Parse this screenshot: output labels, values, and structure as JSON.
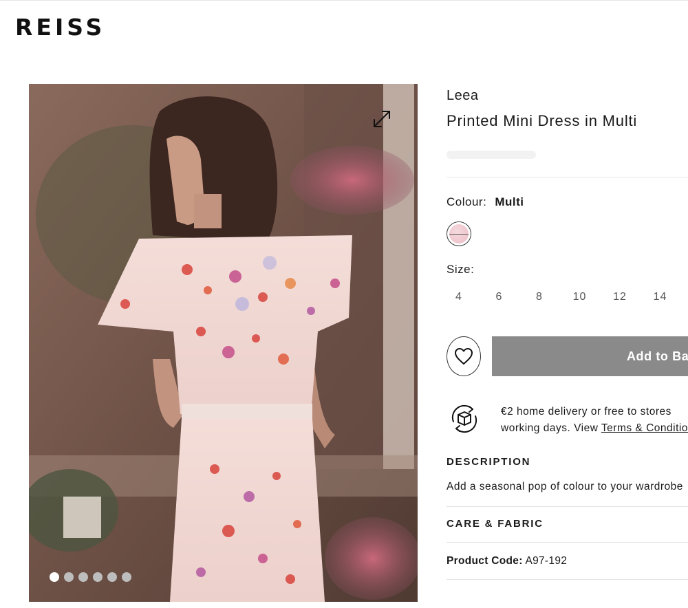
{
  "header": {
    "logo": "REISS"
  },
  "gallery": {
    "image_description_icon": "expand-icon",
    "dot_count": 6,
    "active_index": 0
  },
  "product": {
    "brand": "Leea",
    "title": "Printed Mini Dress in Multi",
    "colour_label": "Colour:",
    "colour_value": "Multi",
    "size_label": "Size:",
    "sizes": [
      "4",
      "6",
      "8",
      "10",
      "12",
      "14"
    ],
    "add_to_bag": "Add to Bag",
    "delivery_line1": "€2 home delivery or free to stores",
    "delivery_line2_prefix": "working days. View ",
    "delivery_link": "Terms & Conditions",
    "description_heading": "DESCRIPTION",
    "description_text": "Add a seasonal pop of colour to your wardrobe",
    "care_heading": "CARE & FABRIC",
    "code_label": "Product Code:",
    "code_value": "A97-192"
  },
  "colors": {
    "add_button_bg": "#8a8a8a",
    "text": "#1a1a1a"
  }
}
